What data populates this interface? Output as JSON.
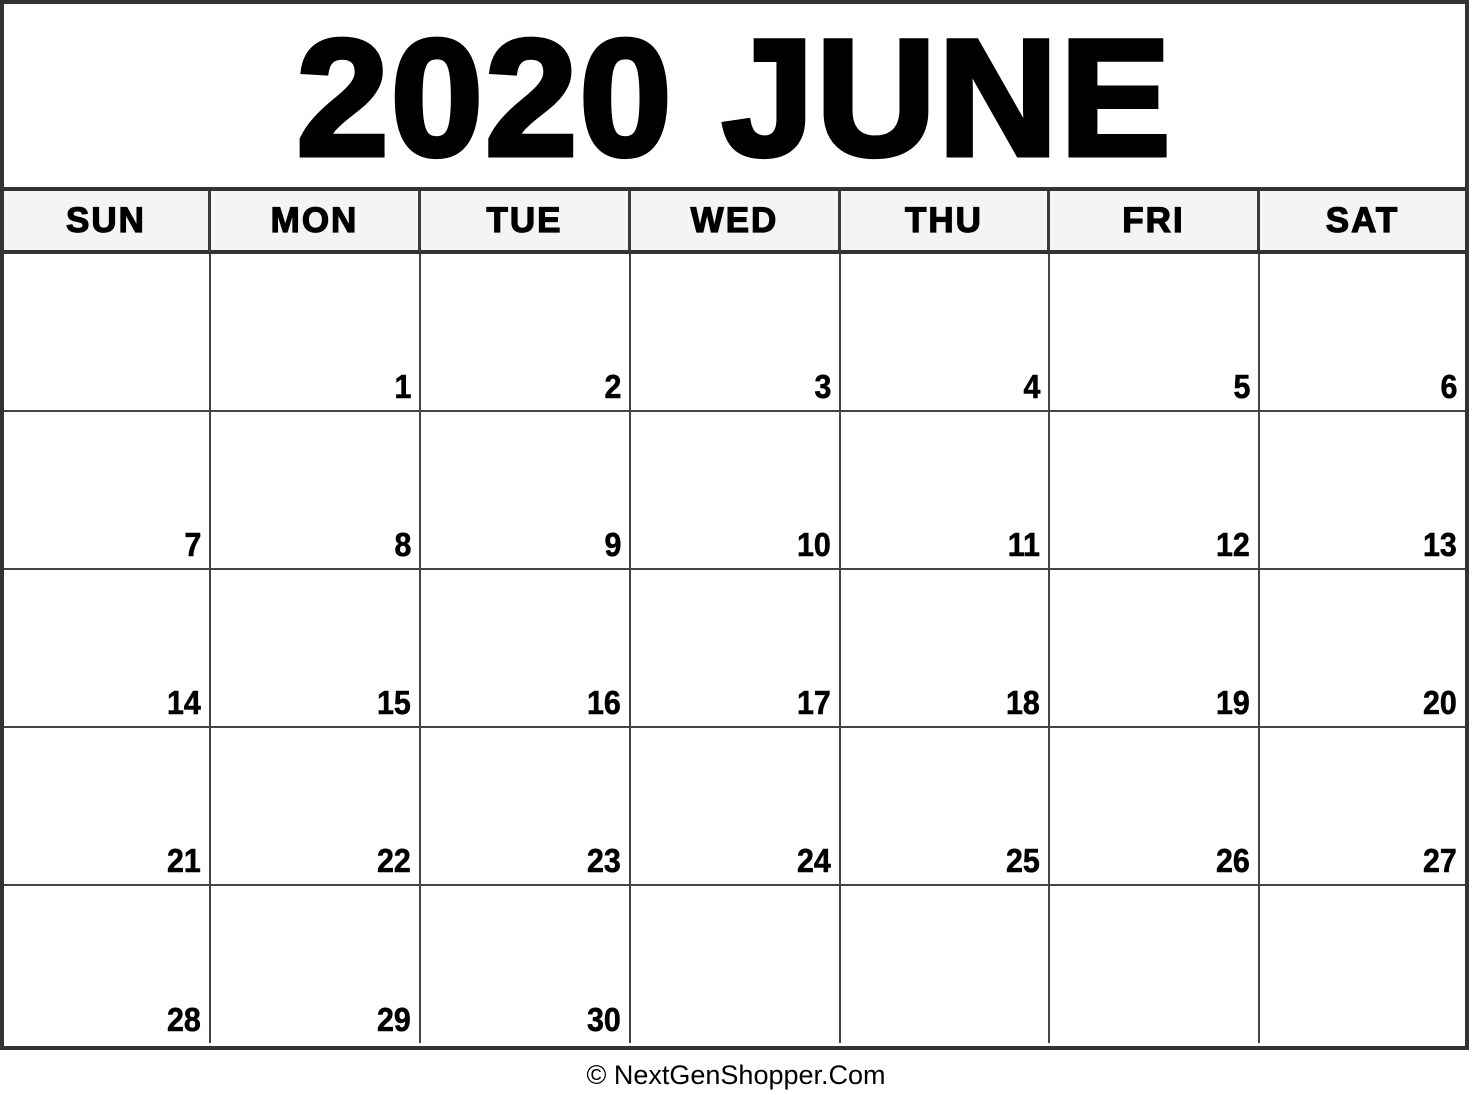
{
  "title": "2020 JUNE",
  "weekdays": [
    "SUN",
    "MON",
    "TUE",
    "WED",
    "THU",
    "FRI",
    "SAT"
  ],
  "weeks": [
    [
      "",
      "1",
      "2",
      "3",
      "4",
      "5",
      "6"
    ],
    [
      "7",
      "8",
      "9",
      "10",
      "11",
      "12",
      "13"
    ],
    [
      "14",
      "15",
      "16",
      "17",
      "18",
      "19",
      "20"
    ],
    [
      "21",
      "22",
      "23",
      "24",
      "25",
      "26",
      "27"
    ],
    [
      "28",
      "29",
      "30",
      "",
      "",
      "",
      ""
    ]
  ],
  "footer": "© NextGenShopper.Com",
  "colors": {
    "border": "#333333",
    "header_bg": "#f4f4f4",
    "text": "#000000"
  }
}
